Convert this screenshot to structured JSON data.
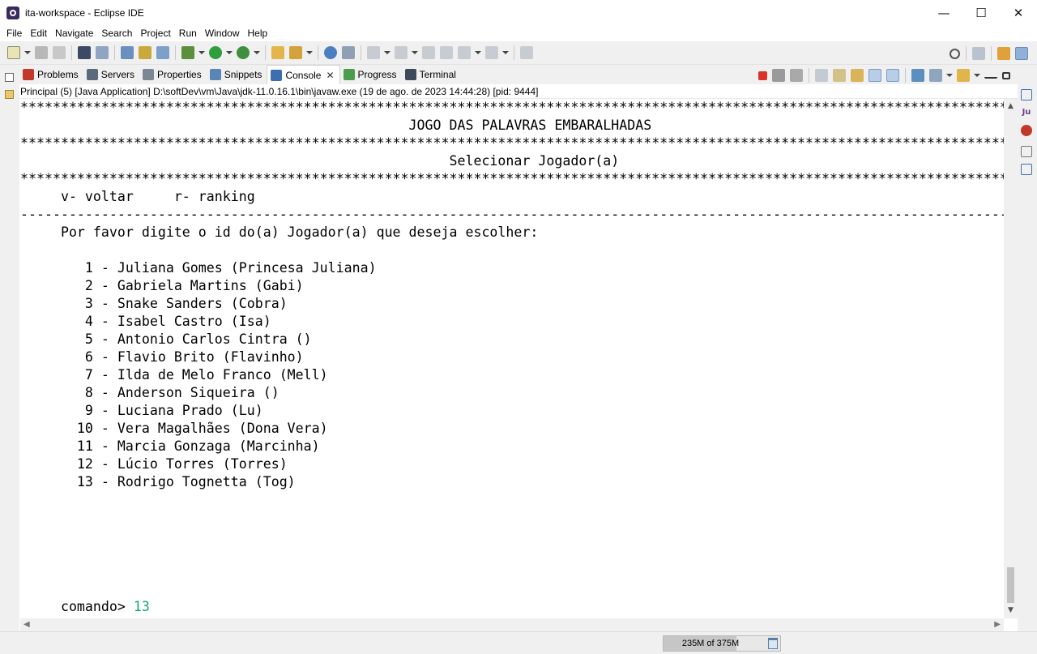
{
  "window": {
    "title": "ita-workspace - Eclipse IDE",
    "controls": [
      "—",
      "☐",
      "✕"
    ]
  },
  "menu": [
    "File",
    "Edit",
    "Navigate",
    "Search",
    "Project",
    "Run",
    "Window",
    "Help"
  ],
  "view_tabs": [
    {
      "label": "Problems",
      "icon": "problems-icon",
      "color": "#c0392b"
    },
    {
      "label": "Servers",
      "icon": "servers-icon",
      "color": "#5b6a7b"
    },
    {
      "label": "Properties",
      "icon": "properties-icon",
      "color": "#7b8794"
    },
    {
      "label": "Snippets",
      "icon": "snippets-icon",
      "color": "#5a86b5"
    },
    {
      "label": "Console",
      "icon": "console-icon",
      "color": "#3d6fb0",
      "active": true,
      "closable": "✕"
    },
    {
      "label": "Progress",
      "icon": "progress-icon",
      "color": "#4a9d4a"
    },
    {
      "label": "Terminal",
      "icon": "terminal-icon",
      "color": "#3c4a5c"
    }
  ],
  "console_header": "Principal (5) [Java Application] D:\\softDev\\vm\\Java\\jdk-11.0.16.1\\bin\\javaw.exe  (19 de ago. de 2023 14:44:28) [pid: 9444]",
  "console": {
    "lines": [
      "********************************************************************************************************************************",
      "                                                JOGO DAS PALAVRAS EMBARALHADAS",
      "********************************************************************************************************************************",
      "                                                     Selecionar Jogador(a)",
      "********************************************************************************************************************************",
      "     v- voltar     r- ranking",
      "--------------------------------------------------------------------------------------------------------------------------------",
      "     Por favor digite o id do(a) Jogador(a) que deseja escolher:",
      "",
      "        1 - Juliana Gomes (Princesa Juliana)",
      "        2 - Gabriela Martins (Gabi)",
      "        3 - Snake Sanders (Cobra)",
      "        4 - Isabel Castro (Isa)",
      "        5 - Antonio Carlos Cintra ()",
      "        6 - Flavio Brito (Flavinho)",
      "        7 - Ilda de Melo Franco (Mell)",
      "        8 - Anderson Siqueira ()",
      "        9 - Luciana Prado (Lu)",
      "       10 - Vera Magalhães (Dona Vera)",
      "       11 - Marcia Gonzaga (Marcinha)",
      "       12 - Lúcio Torres (Torres)",
      "       13 - Rodrigo Tognetta (Tog)",
      "",
      "",
      "",
      "",
      "",
      ""
    ],
    "prompt": "     comando> ",
    "input_value": "13",
    "input_color": "#12a57f"
  },
  "status": {
    "heap_label": "235M of 375M",
    "heap_used_fraction": 0.627
  },
  "right_trim": [
    {
      "icon": "minimized-view-icon",
      "text": "",
      "color": "#777777"
    },
    {
      "icon": "outline-icon",
      "text": "",
      "color": "#3d6fb0"
    },
    {
      "icon": "junit-icon",
      "text": "Ju",
      "color": "#6b3f8e"
    },
    {
      "icon": "error-log-icon",
      "text": "",
      "color": "#c0392b"
    },
    {
      "icon": "restore-icon",
      "text": "",
      "color": "#777777"
    },
    {
      "icon": "task-list-icon",
      "text": "",
      "color": "#3d6fb0"
    }
  ]
}
